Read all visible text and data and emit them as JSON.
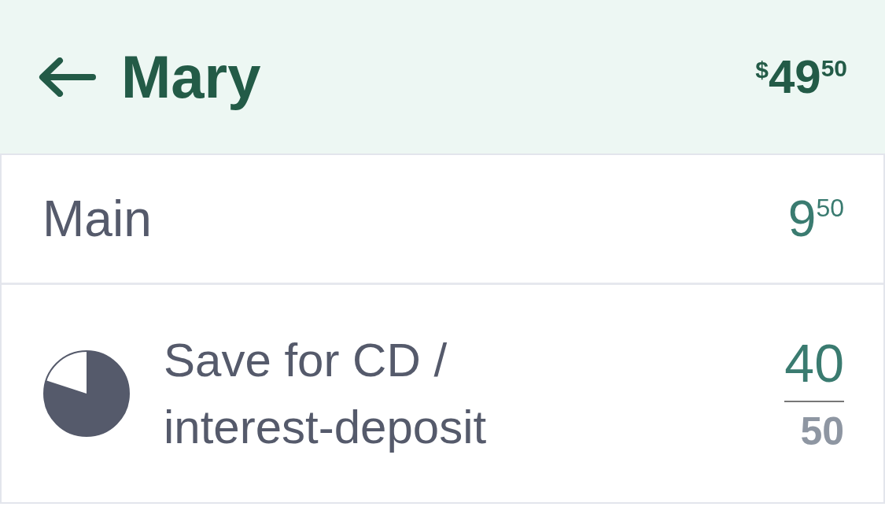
{
  "header": {
    "title": "Mary",
    "balance": {
      "currency": "$",
      "whole": "49",
      "cents": "50"
    }
  },
  "accounts": [
    {
      "kind": "main",
      "name": "Main",
      "whole": "9",
      "cents": "50"
    },
    {
      "kind": "goal",
      "name": "Save for CD / interest-deposit",
      "saved": "40",
      "target": "50"
    }
  ]
}
